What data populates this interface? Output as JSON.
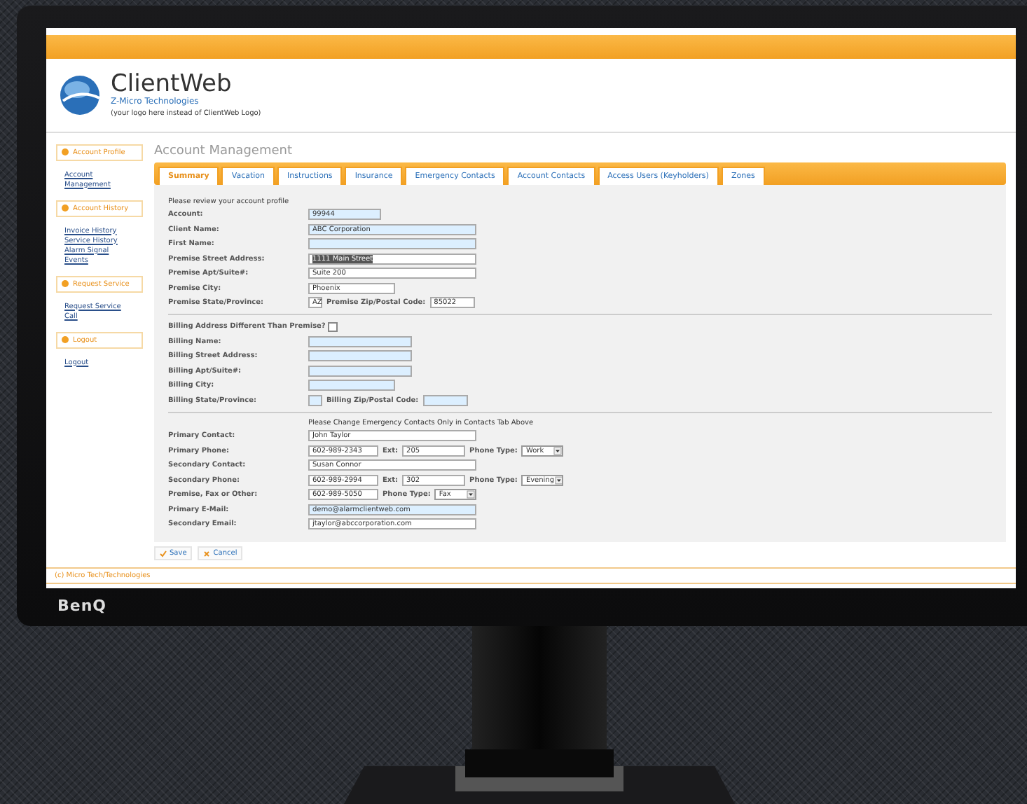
{
  "monitor": {
    "brand": "BenQ"
  },
  "header": {
    "app_name": "ClientWeb",
    "company": "Z-Micro Technologies",
    "tagline": "(your logo here instead of ClientWeb Logo)"
  },
  "sidebar": [
    {
      "title": "Account Profile",
      "links": [
        "Account Management"
      ]
    },
    {
      "title": "Account History",
      "links": [
        "Invoice History",
        "Service History",
        "Alarm Signal Events"
      ]
    },
    {
      "title": "Request Service",
      "links": [
        "Request Service Call"
      ]
    },
    {
      "title": "Logout",
      "links": [
        "Logout"
      ]
    }
  ],
  "page_title": "Account Management",
  "tabs": [
    {
      "label": "Summary",
      "selected": true
    },
    {
      "label": "Vacation",
      "selected": false
    },
    {
      "label": "Instructions",
      "selected": false
    },
    {
      "label": "Insurance",
      "selected": false
    },
    {
      "label": "Emergency Contacts",
      "selected": false
    },
    {
      "label": "Account Contacts",
      "selected": false
    },
    {
      "label": "Access Users (Keyholders)",
      "selected": false
    },
    {
      "label": "Zones",
      "selected": false
    }
  ],
  "sections": [
    {
      "note": "Please review your account profile",
      "rows": [
        {
          "label": "Account:",
          "items": [
            {
              "kind": "input",
              "value": "99944",
              "readonly": true
            }
          ]
        },
        {
          "label": "Client Name:",
          "items": [
            {
              "kind": "input",
              "value": "ABC Corporation",
              "readonly": true
            }
          ]
        },
        {
          "label": "First Name:",
          "items": [
            {
              "kind": "input",
              "readonly": true
            }
          ]
        },
        {
          "label": "Premise Street Address:",
          "items": [
            {
              "kind": "input",
              "value": "1111 Main Street",
              "readonly": false,
              "highlighted": true
            }
          ]
        },
        {
          "label": "Premise Apt/Suite#:",
          "items": [
            {
              "kind": "input",
              "value": "Suite 200",
              "readonly": false
            }
          ]
        },
        {
          "label": "Premise City:",
          "items": [
            {
              "kind": "input",
              "value": "Phoenix",
              "readonly": false
            }
          ]
        },
        {
          "label": "Premise State/Province:",
          "items": [
            {
              "kind": "input",
              "value": "AZ",
              "readonly": false
            },
            {
              "kind": "text",
              "text": "Premise Zip/Postal Code:"
            },
            {
              "kind": "input",
              "value": "85022",
              "readonly": false
            }
          ]
        }
      ]
    },
    {
      "rows": [
        {
          "label": "Billing Address Different Than Premise?",
          "items": [
            {
              "kind": "checkbox",
              "checked": false
            }
          ]
        },
        {
          "label": "Billing Name:",
          "items": [
            {
              "kind": "input",
              "readonly": true
            }
          ]
        },
        {
          "label": "Billing Street Address:",
          "items": [
            {
              "kind": "input",
              "readonly": true
            }
          ]
        },
        {
          "label": "Billing Apt/Suite#:",
          "items": [
            {
              "kind": "input",
              "readonly": true
            }
          ]
        },
        {
          "label": "Billing City:",
          "items": [
            {
              "kind": "input",
              "readonly": true
            }
          ]
        },
        {
          "label": "Billing State/Province:",
          "items": [
            {
              "kind": "input",
              "readonly": true
            },
            {
              "kind": "text",
              "text": "Billing Zip/Postal Code:"
            },
            {
              "kind": "input",
              "readonly": true
            }
          ]
        }
      ]
    },
    {
      "note": "Please Change Emergency Contacts Only in Contacts Tab Above",
      "rows": [
        {
          "label": "Primary Contact:",
          "items": [
            {
              "kind": "input",
              "value": "John Taylor",
              "readonly": false
            }
          ]
        },
        {
          "label": "Primary Phone:",
          "items": [
            {
              "kind": "input",
              "value": "602-989-2343",
              "readonly": false
            },
            {
              "kind": "text",
              "text": "Ext:"
            },
            {
              "kind": "input",
              "value": "205",
              "readonly": false
            },
            {
              "kind": "text",
              "text": "Phone Type:"
            },
            {
              "kind": "select",
              "value": "Work"
            }
          ]
        },
        {
          "label": "Secondary Contact:",
          "items": [
            {
              "kind": "input",
              "value": "Susan Connor",
              "readonly": false
            }
          ]
        },
        {
          "label": "Secondary Phone:",
          "items": [
            {
              "kind": "input",
              "value": "602-989-2994",
              "readonly": false
            },
            {
              "kind": "text",
              "text": "Ext:"
            },
            {
              "kind": "input",
              "value": "302",
              "readonly": false
            },
            {
              "kind": "text",
              "text": "Phone Type:"
            },
            {
              "kind": "select",
              "value": "Evening"
            }
          ]
        },
        {
          "label": "Premise, Fax or Other:",
          "items": [
            {
              "kind": "input",
              "value": "602-989-5050",
              "readonly": false
            },
            {
              "kind": "text",
              "text": "Phone Type:"
            },
            {
              "kind": "select",
              "value": "Fax"
            }
          ]
        },
        {
          "label": "Primary E-Mail:",
          "items": [
            {
              "kind": "input",
              "value": "demo@alarmclientweb.com",
              "readonly": true
            }
          ]
        },
        {
          "label": "Secondary Email:",
          "items": [
            {
              "kind": "input",
              "value": "jtaylor@abccorporation.com",
              "readonly": false
            }
          ]
        }
      ]
    }
  ],
  "actions": [
    {
      "kind": "save",
      "label": "Save"
    },
    {
      "kind": "cancel",
      "label": "Cancel"
    }
  ],
  "footer": "(c) Micro Tech/Technologies"
}
